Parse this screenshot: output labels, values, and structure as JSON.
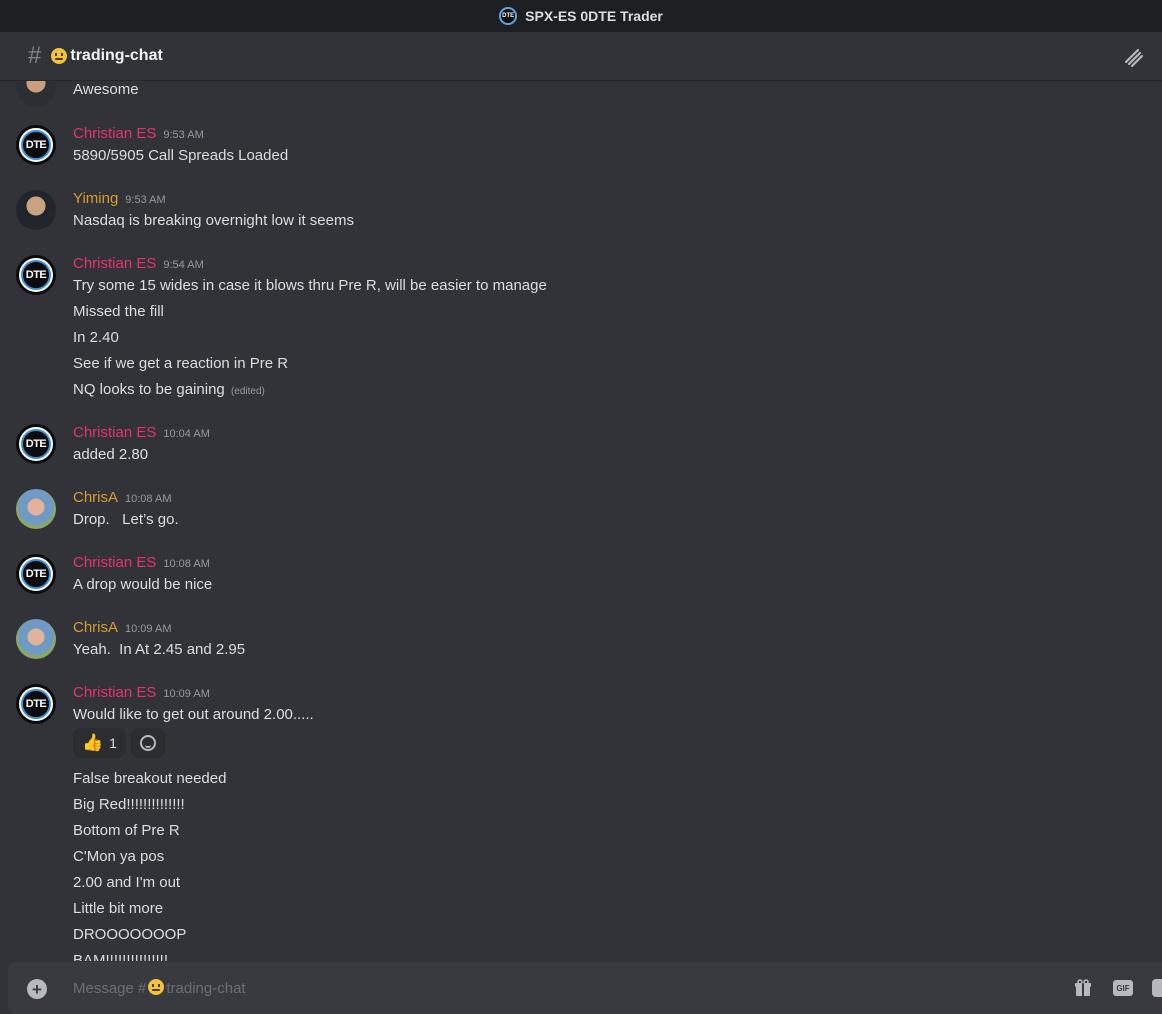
{
  "window": {
    "title": "SPX-ES 0DTE Trader",
    "logo_text": "DTE"
  },
  "channel": {
    "name": "trading-chat"
  },
  "colors": {
    "christian": "#e7336a",
    "yellow_user": "#d69e2e",
    "bg": "#313338"
  },
  "messages": [
    {
      "user": "",
      "time": "",
      "avatar": "photo-top",
      "lines": [
        "Awesome"
      ]
    },
    {
      "user": "Christian ES",
      "time": "9:53 AM",
      "avatar": "dte",
      "color": "#e7336a",
      "lines": [
        "5890/5905 Call Spreads Loaded"
      ]
    },
    {
      "user": "Yiming",
      "time": "9:53 AM",
      "avatar": "photo-yiming",
      "color": "#d69e2e",
      "lines": [
        "Nasdaq is breaking overnight low it seems"
      ]
    },
    {
      "user": "Christian ES",
      "time": "9:54 AM",
      "avatar": "dte",
      "color": "#e7336a",
      "lines": [
        "Try some 15 wides in case it blows thru Pre R, will be easier to manage",
        "Missed the fill",
        "In 2.40",
        "See if we get a reaction in Pre R",
        "NQ looks to be gaining"
      ],
      "edited": "(edited)"
    },
    {
      "user": "Christian ES",
      "time": "10:04 AM",
      "avatar": "dte",
      "color": "#e7336a",
      "lines": [
        "added 2.80"
      ]
    },
    {
      "user": "ChrisA",
      "time": "10:08 AM",
      "avatar": "photo-chris",
      "color": "#d69e2e",
      "lines": [
        "Drop.   Let’s go."
      ]
    },
    {
      "user": "Christian ES",
      "time": "10:08 AM",
      "avatar": "dte",
      "color": "#e7336a",
      "lines": [
        "A drop would be nice"
      ]
    },
    {
      "user": "ChrisA",
      "time": "10:09 AM",
      "avatar": "photo-chris",
      "color": "#d69e2e",
      "lines": [
        "Yeah.  In At 2.45 and 2.95"
      ]
    },
    {
      "user": "Christian ES",
      "time": "10:09 AM",
      "avatar": "dte",
      "color": "#e7336a",
      "lines": [
        "Would like to get out around 2.00.....",
        "False breakout needed",
        "Big Red!!!!!!!!!!!!!!",
        "Bottom of Pre R",
        "C'Mon ya pos",
        "2.00 and I'm out",
        "Little bit more",
        "DROOOOOOOP",
        "BAM!!!!!!!!!!!!!!!"
      ],
      "reaction": {
        "emoji": "👍",
        "count": "1"
      }
    }
  ],
  "composer": {
    "placeholder_prefix": "Message #",
    "placeholder_channel": "trading-chat",
    "gif_label": "GIF"
  }
}
